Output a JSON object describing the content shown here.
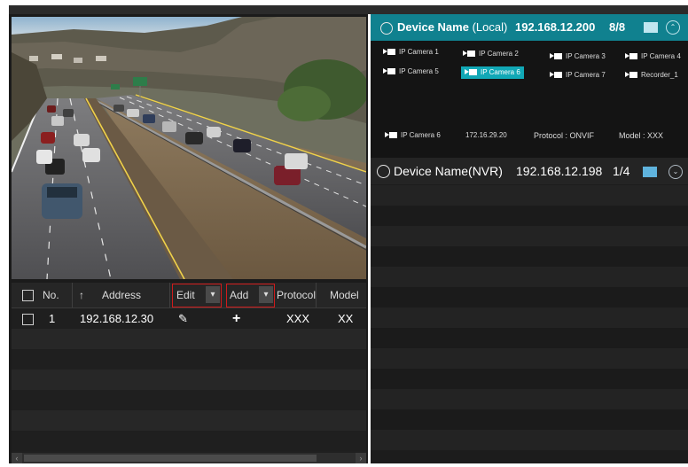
{
  "table": {
    "headers": {
      "no": "No.",
      "address": "Address",
      "edit": "Edit",
      "add": "Add",
      "protocol": "Protocol",
      "model": "Model"
    },
    "rows": [
      {
        "no": "1",
        "address": "192.168.12.30",
        "protocol": "XXX",
        "model": "XX"
      }
    ]
  },
  "devices": {
    "local": {
      "name": "Device Name",
      "type": "(Local)",
      "ip": "192.168.12.200",
      "count": "8/8",
      "cameras": [
        "IP Camera 1",
        "IP Camera 2",
        "IP Camera 3",
        "IP Camera 4",
        "IP Camera 5",
        "IP Camera 6",
        "IP Camera 7",
        "Recorder_1"
      ],
      "selected_camera": "IP Camera 6",
      "detail": {
        "camera": "IP Camera 6",
        "ip": "172.16.29.20",
        "protocol": "Protocol : ONVIF",
        "model": "Model : XXX"
      }
    },
    "nvr": {
      "name": "Device Name",
      "type": "(NVR)",
      "ip": "192.168.12.198",
      "count": "1/4"
    }
  },
  "colors": {
    "accent": "#10818f",
    "selected": "#11a8b6",
    "highlight_box": "#d01b1b"
  },
  "icons": {
    "sort": "up-arrow-icon",
    "edit": "pencil-icon",
    "add": "plus-icon",
    "camera": "camera-icon",
    "monitor": "monitor-icon"
  }
}
